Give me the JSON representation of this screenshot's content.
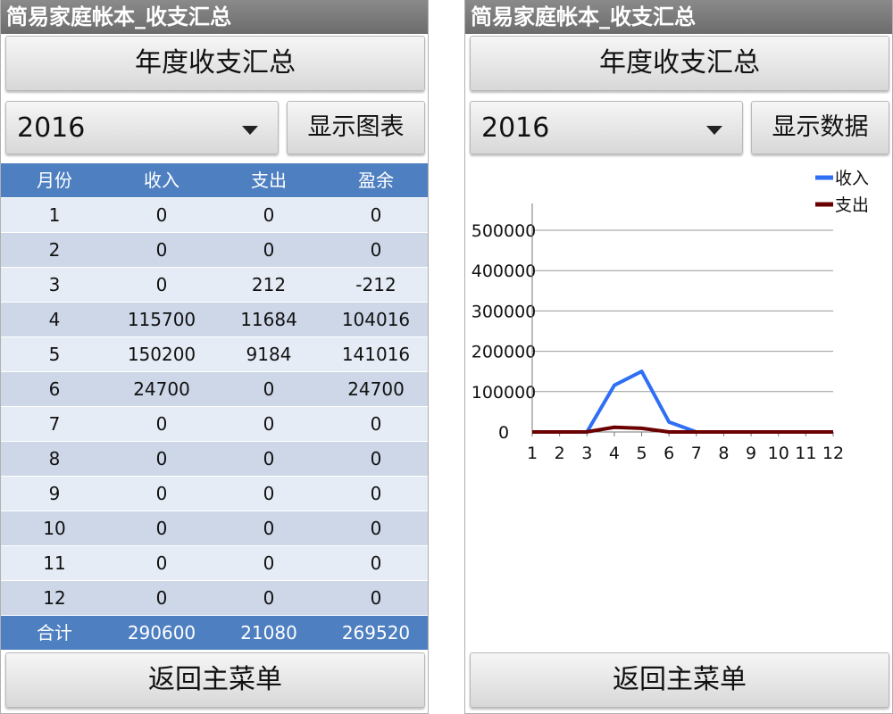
{
  "app_title": "简易家庭帐本_收支汇总",
  "summary_button_label": "年度收支汇总",
  "year_select_value": "2016",
  "left": {
    "toggle_button_label": "显示图表",
    "table": {
      "headers": [
        "月份",
        "收入",
        "支出",
        "盈余"
      ],
      "rows": [
        [
          "1",
          "0",
          "0",
          "0"
        ],
        [
          "2",
          "0",
          "0",
          "0"
        ],
        [
          "3",
          "0",
          "212",
          "-212"
        ],
        [
          "4",
          "115700",
          "11684",
          "104016"
        ],
        [
          "5",
          "150200",
          "9184",
          "141016"
        ],
        [
          "6",
          "24700",
          "0",
          "24700"
        ],
        [
          "7",
          "0",
          "0",
          "0"
        ],
        [
          "8",
          "0",
          "0",
          "0"
        ],
        [
          "9",
          "0",
          "0",
          "0"
        ],
        [
          "10",
          "0",
          "0",
          "0"
        ],
        [
          "11",
          "0",
          "0",
          "0"
        ],
        [
          "12",
          "0",
          "0",
          "0"
        ]
      ],
      "total": [
        "合计",
        "290600",
        "21080",
        "269520"
      ]
    }
  },
  "right": {
    "toggle_button_label": "显示数据"
  },
  "back_button_label": "返回主菜单",
  "chart_data": {
    "type": "line",
    "title": "",
    "xlabel": "",
    "ylabel": "",
    "x": [
      1,
      2,
      3,
      4,
      5,
      6,
      7,
      8,
      9,
      10,
      11,
      12
    ],
    "ylim": [
      0,
      500000
    ],
    "yticks": [
      0,
      100000,
      200000,
      300000,
      400000,
      500000
    ],
    "grid": true,
    "legend_position": "top-right",
    "series": [
      {
        "name": "收入",
        "color": "#2f6ff5",
        "values": [
          0,
          0,
          0,
          115700,
          150200,
          24700,
          0,
          0,
          0,
          0,
          0,
          0
        ]
      },
      {
        "name": "支出",
        "color": "#6b0000",
        "values": [
          0,
          0,
          212,
          11684,
          9184,
          0,
          0,
          0,
          0,
          0,
          0,
          0
        ]
      }
    ]
  }
}
